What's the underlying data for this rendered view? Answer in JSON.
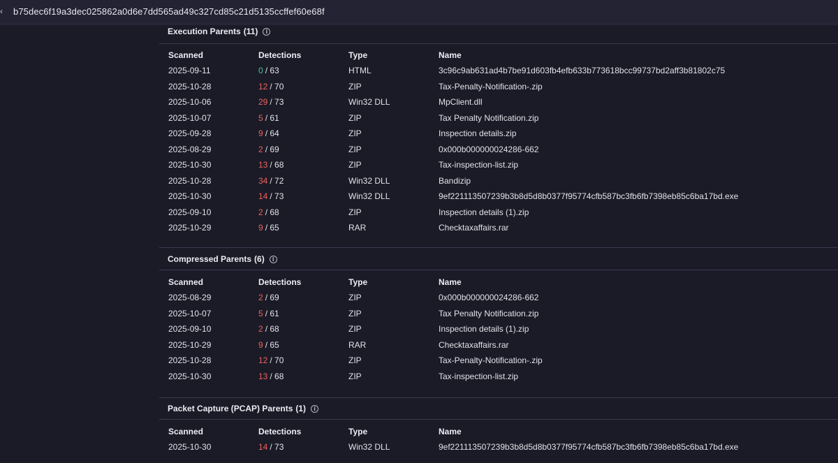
{
  "topbar": {
    "back_icon": "chevron-left-icon",
    "hash": "b75dec6f19a3dec025862a0d6e7dd565ad49c327cd85c21d5135ccffef60e68f"
  },
  "columns": [
    "Scanned",
    "Detections",
    "Type",
    "Name"
  ],
  "colors": {
    "positive_detection": "#f0605a",
    "zero_detection": "#4cc29a",
    "background": "#1b1b27"
  },
  "sections": [
    {
      "title": "Execution Parents",
      "count": "(11)",
      "rows": [
        {
          "scanned": "2025-09-11",
          "det": "0",
          "total": "/ 63",
          "type": "HTML",
          "name": "3c96c9ab631ad4b7be91d603fb4efb633b773618bcc99737bd2aff3b81802c75"
        },
        {
          "scanned": "2025-10-28",
          "det": "12",
          "total": "/ 70",
          "type": "ZIP",
          "name": "Tax-Penalty-Notification-.zip"
        },
        {
          "scanned": "2025-10-06",
          "det": "29",
          "total": "/ 73",
          "type": "Win32 DLL",
          "name": "MpClient.dll"
        },
        {
          "scanned": "2025-10-07",
          "det": "5",
          "total": "/ 61",
          "type": "ZIP",
          "name": "Tax Penalty Notification.zip"
        },
        {
          "scanned": "2025-09-28",
          "det": "9",
          "total": "/ 64",
          "type": "ZIP",
          "name": "Inspection details.zip"
        },
        {
          "scanned": "2025-08-29",
          "det": "2",
          "total": "/ 69",
          "type": "ZIP",
          "name": "0x000b000000024286-662"
        },
        {
          "scanned": "2025-10-30",
          "det": "13",
          "total": "/ 68",
          "type": "ZIP",
          "name": "Tax-inspection-list.zip"
        },
        {
          "scanned": "2025-10-28",
          "det": "34",
          "total": "/ 72",
          "type": "Win32 DLL",
          "name": "Bandizip"
        },
        {
          "scanned": "2025-10-30",
          "det": "14",
          "total": "/ 73",
          "type": "Win32 DLL",
          "name": "9ef221113507239b3b8d5d8b0377f95774cfb587bc3fb6fb7398eb85c6ba17bd.exe"
        },
        {
          "scanned": "2025-09-10",
          "det": "2",
          "total": "/ 68",
          "type": "ZIP",
          "name": "Inspection details (1).zip"
        },
        {
          "scanned": "2025-10-29",
          "det": "9",
          "total": "/ 65",
          "type": "RAR",
          "name": "Checktaxaffairs.rar"
        }
      ]
    },
    {
      "title": "Compressed Parents",
      "count": "(6)",
      "rows": [
        {
          "scanned": "2025-08-29",
          "det": "2",
          "total": "/ 69",
          "type": "ZIP",
          "name": "0x000b000000024286-662"
        },
        {
          "scanned": "2025-10-07",
          "det": "5",
          "total": "/ 61",
          "type": "ZIP",
          "name": "Tax Penalty Notification.zip"
        },
        {
          "scanned": "2025-09-10",
          "det": "2",
          "total": "/ 68",
          "type": "ZIP",
          "name": "Inspection details (1).zip"
        },
        {
          "scanned": "2025-10-29",
          "det": "9",
          "total": "/ 65",
          "type": "RAR",
          "name": "Checktaxaffairs.rar"
        },
        {
          "scanned": "2025-10-28",
          "det": "12",
          "total": "/ 70",
          "type": "ZIP",
          "name": "Tax-Penalty-Notification-.zip"
        },
        {
          "scanned": "2025-10-30",
          "det": "13",
          "total": "/ 68",
          "type": "ZIP",
          "name": "Tax-inspection-list.zip"
        }
      ]
    },
    {
      "title": "Packet Capture (PCAP) Parents",
      "count": "(1)",
      "rows": [
        {
          "scanned": "2025-10-30",
          "det": "14",
          "total": "/ 73",
          "type": "Win32 DLL",
          "name": "9ef221113507239b3b8d5d8b0377f95774cfb587bc3fb6fb7398eb85c6ba17bd.exe"
        }
      ]
    }
  ]
}
